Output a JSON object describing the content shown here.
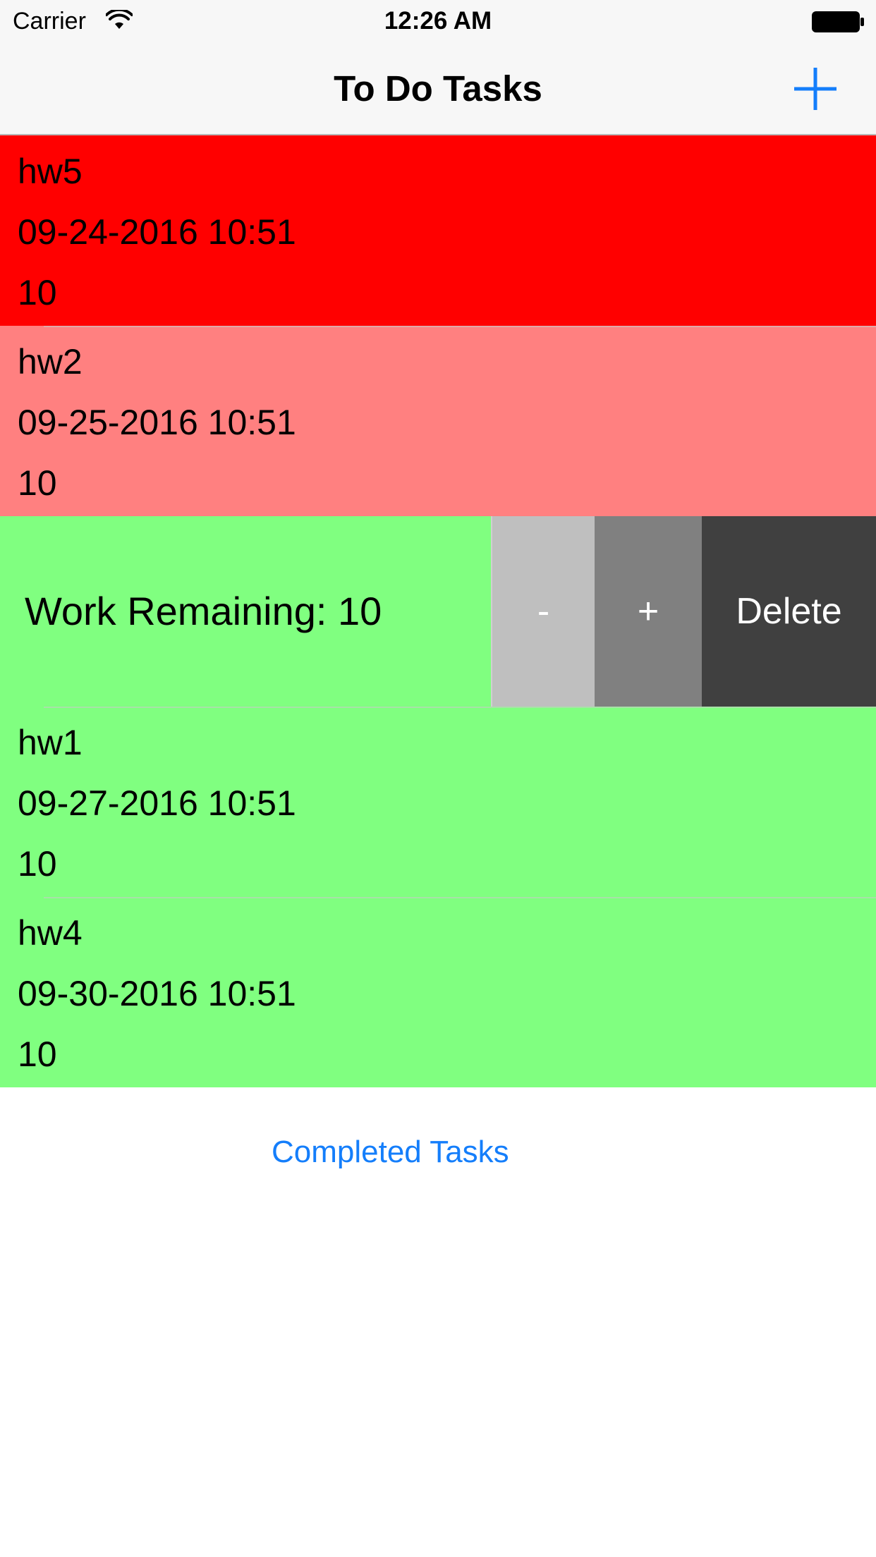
{
  "status_bar": {
    "carrier": "Carrier",
    "time": "12:26 AM",
    "wifi_icon": "wifi-icon",
    "battery_icon": "battery-icon"
  },
  "nav": {
    "title": "To Do Tasks",
    "add_icon": "plus-icon"
  },
  "colors": {
    "accent": "#147efb",
    "overdue": "#ff0000",
    "due_soon": "#ff8080",
    "ok": "#80ff80",
    "btn_decrement": "#bfbfbf",
    "btn_increment": "#808080",
    "btn_delete": "#404040"
  },
  "tasks": [
    {
      "name": "hw5",
      "due": "09-24-2016 10:51",
      "work": "10",
      "color": "#ff0000"
    },
    {
      "name": "hw2",
      "due": "09-25-2016 10:51",
      "work": "10",
      "color": "#ff8080"
    },
    {
      "name": "hw1",
      "due": "09-27-2016 10:51",
      "work": "10",
      "color": "#80ff80"
    },
    {
      "name": "hw4",
      "due": "09-30-2016 10:51",
      "work": "10",
      "color": "#80ff80"
    }
  ],
  "swiped_row": {
    "label": "Work Remaining: 10",
    "actions": {
      "decrement": "-",
      "increment": "+",
      "delete": "Delete"
    }
  },
  "footer": {
    "completed_link": "Completed Tasks"
  }
}
